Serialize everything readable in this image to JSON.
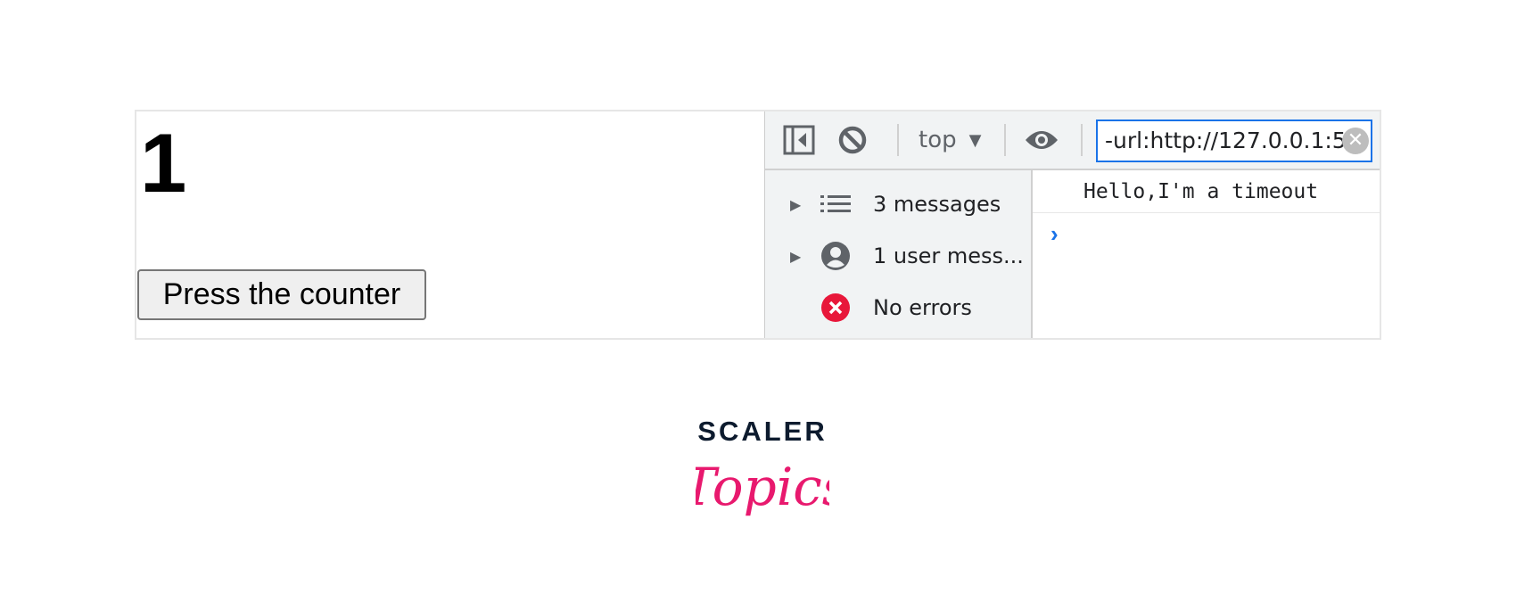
{
  "page": {
    "counter_value": "1",
    "button_label": "Press the counter"
  },
  "devtools": {
    "toolbar": {
      "context_label": "top",
      "filter_value": "-url:http://127.0.0.1:5",
      "icons": [
        "sidebar-toggle-icon",
        "clear-console-icon",
        "dropdown-arrow-icon",
        "eye-icon",
        "clear-filter-icon"
      ]
    },
    "sidebar": {
      "items": [
        {
          "label": "3 messages",
          "icon": "list-icon"
        },
        {
          "label": "1 user mess...",
          "icon": "user-icon"
        },
        {
          "label": "No errors",
          "icon": "error-icon"
        }
      ]
    },
    "console": {
      "messages": [
        "Hello,I'm a timeout"
      ],
      "prompt": "›"
    },
    "colors": {
      "accent": "#1a73e8",
      "error": "#e8173a"
    }
  },
  "logo": {
    "line1": "SCALER",
    "line2": "Topics",
    "colors": {
      "dark": "#0d1b2e",
      "pink": "#e8196e"
    }
  }
}
